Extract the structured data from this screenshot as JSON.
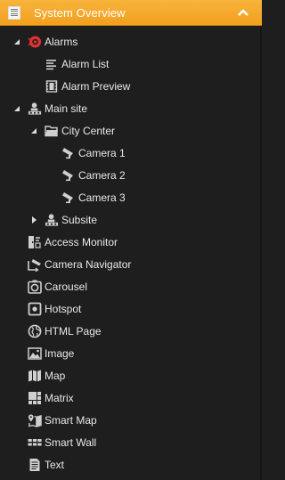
{
  "header": {
    "title": "System Overview",
    "icon": "list-panel-icon",
    "collapse_icon": "chevron-up-icon",
    "accent": "#f4a623"
  },
  "tree": [
    {
      "label": "Alarms",
      "icon": "alarm-icon",
      "expander": "expanded"
    },
    {
      "label": "Alarm List",
      "icon": "list-icon"
    },
    {
      "label": "Alarm Preview",
      "icon": "film-icon"
    },
    {
      "label": "Main site",
      "icon": "site-icon",
      "expander": "expanded"
    },
    {
      "label": "City Center",
      "icon": "folder-icon",
      "expander": "expanded"
    },
    {
      "label": "Camera 1",
      "icon": "camera-icon"
    },
    {
      "label": "Camera 2",
      "icon": "camera-icon"
    },
    {
      "label": "Camera 3",
      "icon": "camera-icon"
    },
    {
      "label": "Subsite",
      "icon": "site-icon",
      "expander": "collapsed"
    },
    {
      "label": "Access Monitor",
      "icon": "access-monitor-icon"
    },
    {
      "label": "Camera Navigator",
      "icon": "camera-navigator-icon"
    },
    {
      "label": "Carousel",
      "icon": "carousel-icon"
    },
    {
      "label": "Hotspot",
      "icon": "hotspot-icon"
    },
    {
      "label": "HTML Page",
      "icon": "globe-icon"
    },
    {
      "label": "Image",
      "icon": "image-icon"
    },
    {
      "label": "Map",
      "icon": "map-icon"
    },
    {
      "label": "Matrix",
      "icon": "matrix-icon"
    },
    {
      "label": "Smart Map",
      "icon": "smart-map-icon"
    },
    {
      "label": "Smart Wall",
      "icon": "smart-wall-icon"
    },
    {
      "label": "Text",
      "icon": "text-icon"
    }
  ]
}
